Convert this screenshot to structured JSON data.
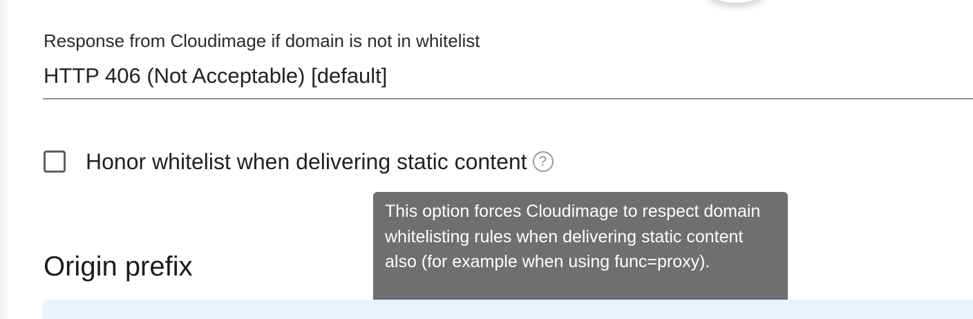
{
  "whitelist_response": {
    "label": "Response from Cloudimage if domain is not in whitelist",
    "selected_value": "HTTP 406 (Not Acceptable) [default]"
  },
  "honor_whitelist": {
    "label": "Honor whitelist when delivering static content",
    "checked": false,
    "help_glyph": "?",
    "tooltip": "This option forces Cloudimage to respect domain whitelisting rules when delivering static content also (for example when using func=proxy)."
  },
  "origin_prefix": {
    "title": "Origin prefix"
  },
  "icons": {
    "help": "help-circle-icon"
  },
  "colors": {
    "tooltip_bg": "#6f6f6f",
    "info_banner_bg": "#e8f3fc",
    "underline": "#8c8c8c"
  }
}
